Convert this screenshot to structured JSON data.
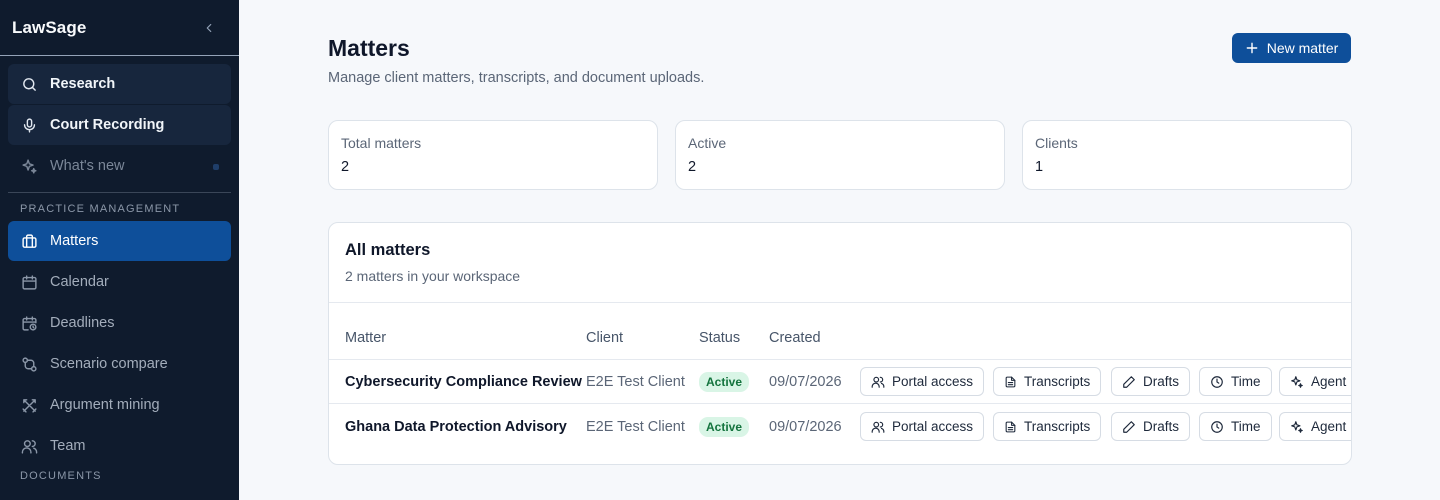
{
  "app": {
    "name": "LawSage"
  },
  "sidebar": {
    "top_items": [
      {
        "label": "Research",
        "icon": "search-icon"
      },
      {
        "label": "Court Recording",
        "icon": "microphone-icon"
      },
      {
        "label": "What's new",
        "icon": "sparkles-icon"
      }
    ],
    "sections": [
      {
        "title": "PRACTICE MANAGEMENT",
        "items": [
          {
            "label": "Matters",
            "icon": "briefcase-icon",
            "active": true
          },
          {
            "label": "Calendar",
            "icon": "calendar-icon"
          },
          {
            "label": "Deadlines",
            "icon": "calendar-clock-icon"
          },
          {
            "label": "Scenario compare",
            "icon": "git-compare-icon"
          },
          {
            "label": "Argument mining",
            "icon": "swords-icon"
          },
          {
            "label": "Team",
            "icon": "users-icon"
          }
        ]
      },
      {
        "title": "DOCUMENTS",
        "items": []
      }
    ]
  },
  "header": {
    "title": "Matters",
    "subtitle": "Manage client matters, transcripts, and document uploads.",
    "new_button": "New matter"
  },
  "stats": [
    {
      "label": "Total matters",
      "value": "2"
    },
    {
      "label": "Active",
      "value": "2"
    },
    {
      "label": "Clients",
      "value": "1"
    }
  ],
  "table": {
    "title": "All matters",
    "subtitle": "2 matters in your workspace",
    "columns": [
      "Matter",
      "Client",
      "Status",
      "Created"
    ],
    "actions": [
      {
        "label": "Portal access",
        "icon": "users-icon"
      },
      {
        "label": "Transcripts",
        "icon": "file-text-icon"
      },
      {
        "label": "Drafts",
        "icon": "pencil-icon"
      },
      {
        "label": "Time",
        "icon": "clock-icon"
      },
      {
        "label": "Agent",
        "icon": "sparkles-icon"
      }
    ],
    "rows": [
      {
        "matter": "Cybersecurity Compliance Review",
        "client": "E2E Test Client",
        "status": "Active",
        "created": "09/07/2026"
      },
      {
        "matter": "Ghana Data Protection Advisory",
        "client": "E2E Test Client",
        "status": "Active",
        "created": "09/07/2026"
      }
    ]
  },
  "colors": {
    "sidebar_bg": "#0f1b2d",
    "accent": "#0e4f9a",
    "badge_bg": "#d9f5e6",
    "badge_text": "#14743e"
  }
}
